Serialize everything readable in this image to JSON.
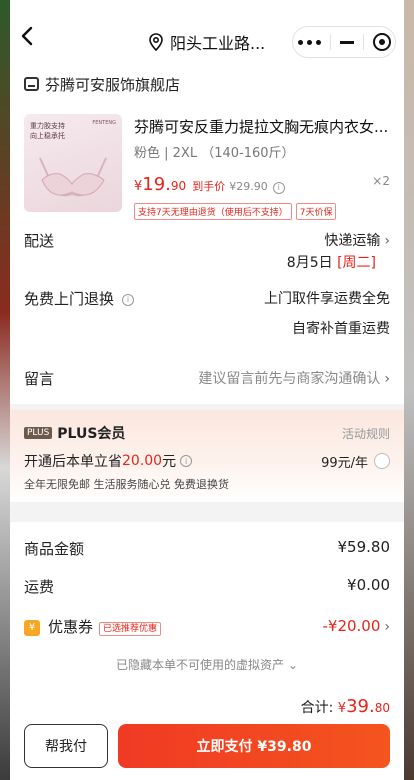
{
  "header": {
    "location": "阳头工业路..."
  },
  "shop": {
    "name": "芬腾可安服饰旗舰店"
  },
  "product": {
    "title": "芬腾可安反重力提拉文胸无痕内衣女...",
    "sku": "粉色 | 2XL （140-160斤）",
    "price_symbol": "¥",
    "price_int": "19.",
    "price_dec": "90",
    "price_label": "到手价",
    "original_price": "¥29.90",
    "quantity": "×2",
    "tags": [
      "支持7天无理由退货（使用后不支持）",
      "7天价保"
    ],
    "thumb_tagline": "重力胶支持 向上稳承托",
    "thumb_brand": "FENTENG"
  },
  "delivery": {
    "label": "配送",
    "method": "快递运输",
    "date": "8月5日",
    "weekday": "[周二]"
  },
  "returns": {
    "label": "免费上门退换",
    "line1": "上门取件享运费全免",
    "line2": "自寄补首重运费"
  },
  "message": {
    "label": "留言",
    "placeholder": "建议留言前先与商家沟通确认"
  },
  "plus": {
    "badge": "PLUS",
    "title": "PLUS会员",
    "rules": "活动规则",
    "save_prefix": "开通后本单立省",
    "save_amount": "20.00",
    "save_suffix": "元",
    "price": "99元/年",
    "perks": "全年无限免邮 生活服务随心兑 免费退换货"
  },
  "amounts": {
    "goods_label": "商品金额",
    "goods_value": "¥59.80",
    "shipping_label": "运费",
    "shipping_value": "¥0.00",
    "coupon_label": "优惠券",
    "coupon_tag": "已选推荐优惠",
    "coupon_value": "-¥20.00",
    "hidden_note": "已隐藏本单不可使用的虚拟资产",
    "total_label": "合计:",
    "total_symbol": "¥",
    "total_int": "39.",
    "total_dec": "80"
  },
  "actions": {
    "help_label": "帮我付",
    "pay_label": "立即支付 ¥39.80"
  },
  "colors": {
    "accent_red": "#e8231a",
    "pay_button": "#f03a24",
    "plus_badge": "#6e5a4d"
  }
}
